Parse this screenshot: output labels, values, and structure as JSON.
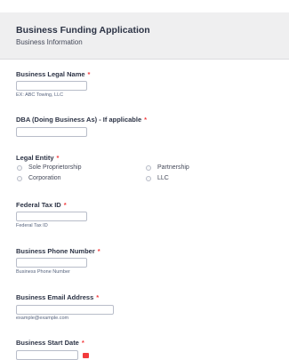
{
  "form": {
    "title": "Business Funding Application",
    "subtitle": "Business Information"
  },
  "fields": {
    "legal_name": {
      "label": "Business Legal Name",
      "required": "*",
      "value": "",
      "sublabel": "EX: ABC Towing, LLC"
    },
    "dba": {
      "label": "DBA (Doing Business As) - If applicable",
      "required": "*",
      "value": ""
    },
    "legal_entity": {
      "label": "Legal Entity",
      "required": "*",
      "options": [
        "Sole Proprietorship",
        "Partnership",
        "Corporation",
        "LLC"
      ]
    },
    "tax_id": {
      "label": "Federal Tax ID",
      "required": "*",
      "value": "",
      "sublabel": "Federal Tax ID"
    },
    "phone": {
      "label": "Business Phone Number",
      "required": "*",
      "value": "",
      "sublabel": "Business Phone Number"
    },
    "email": {
      "label": "Business Email Address",
      "required": "*",
      "value": "",
      "sublabel": "example@example.com"
    },
    "start_date": {
      "label": "Business Start Date",
      "required": "*",
      "value": ""
    }
  },
  "colors": {
    "accent_required": "#f23a3c",
    "header_bg": "#efeff0",
    "text": "#2c3345"
  },
  "icons": {
    "date_picker": "calendar-icon"
  }
}
